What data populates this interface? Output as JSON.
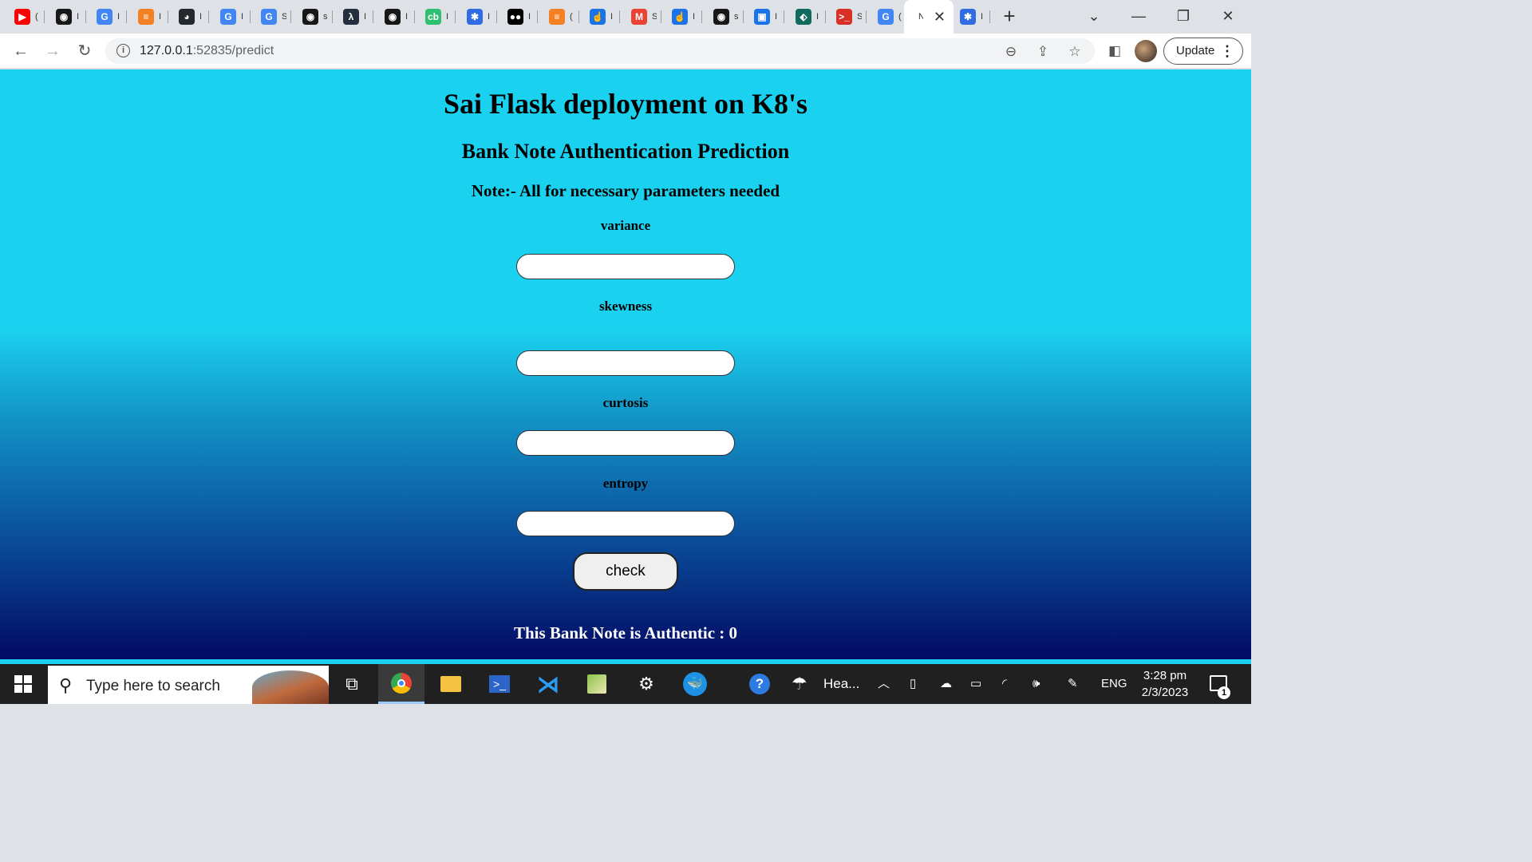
{
  "browser": {
    "tabs": [
      {
        "label": "(",
        "icon": "youtube-icon",
        "color": "#ff0000",
        "glyph": "▶"
      },
      {
        "label": "I",
        "icon": "github-icon",
        "color": "#181717",
        "glyph": "◉"
      },
      {
        "label": "I",
        "icon": "google-icon",
        "color": "#4285f4",
        "glyph": "G"
      },
      {
        "label": "I",
        "icon": "stackoverflow-icon",
        "color": "#f48024",
        "glyph": "≡"
      },
      {
        "label": "I",
        "icon": "octocat-icon",
        "color": "#24292e",
        "glyph": "◕"
      },
      {
        "label": "I",
        "icon": "google-icon",
        "color": "#4285f4",
        "glyph": "G"
      },
      {
        "label": "S",
        "icon": "google-icon",
        "color": "#4285f4",
        "glyph": "G"
      },
      {
        "label": "s",
        "icon": "github-icon",
        "color": "#181717",
        "glyph": "◉"
      },
      {
        "label": "I",
        "icon": "aws-lambda-icon",
        "color": "#232f3e",
        "glyph": "λ"
      },
      {
        "label": "I",
        "icon": "github-icon",
        "color": "#181717",
        "glyph": "◉"
      },
      {
        "label": "I",
        "icon": "cb-icon",
        "color": "#2fbf71",
        "glyph": "cb"
      },
      {
        "label": "I",
        "icon": "kubernetes-icon",
        "color": "#326ce5",
        "glyph": "✱"
      },
      {
        "label": "I",
        "icon": "medium-icon",
        "color": "#000000",
        "glyph": "●●"
      },
      {
        "label": "(",
        "icon": "stackoverflow-icon",
        "color": "#f48024",
        "glyph": "≡"
      },
      {
        "label": "I",
        "icon": "pointer-icon",
        "color": "#1a73e8",
        "glyph": "☝"
      },
      {
        "label": "S",
        "icon": "gmail-icon",
        "color": "#ea4335",
        "glyph": "M"
      },
      {
        "label": "I",
        "icon": "pointer-icon",
        "color": "#1a73e8",
        "glyph": "☝"
      },
      {
        "label": "s",
        "icon": "github-icon",
        "color": "#181717",
        "glyph": "◉"
      },
      {
        "label": "I",
        "icon": "screen-icon",
        "color": "#1a73e8",
        "glyph": "▣"
      },
      {
        "label": "I",
        "icon": "pin-icon",
        "color": "#0f6b5f",
        "glyph": "⬖"
      },
      {
        "label": "S",
        "icon": "terminal-icon",
        "color": "#d93025",
        "glyph": ">_"
      },
      {
        "label": "(",
        "icon": "google-icon",
        "color": "#4285f4",
        "glyph": "G"
      },
      {
        "label": "N",
        "icon": "blank-icon",
        "color": "#ffffff",
        "glyph": "",
        "active": true
      },
      {
        "label": "I",
        "icon": "kubernetes-icon",
        "color": "#326ce5",
        "glyph": "✱"
      }
    ],
    "url_host": "127.0.0.1",
    "url_path": ":52835/predict",
    "update_label": "Update"
  },
  "page": {
    "title": "Sai Flask deployment on K8's",
    "subtitle": "Bank Note Authentication Prediction",
    "note": "Note:- All for necessary parameters needed",
    "fields": [
      {
        "label": "variance",
        "value": ""
      },
      {
        "label": "skewness",
        "value": ""
      },
      {
        "label": "curtosis",
        "value": ""
      },
      {
        "label": "entropy",
        "value": ""
      }
    ],
    "button_label": "check",
    "result": "This Bank Note is Authentic : 0",
    "colors": {
      "background_top": "#1ad2ef",
      "background_bottom": "#020a63"
    }
  },
  "taskbar": {
    "search_placeholder": "Type here to search",
    "weather_label": "Hea...",
    "language": "ENG",
    "time": "3:28 pm",
    "date": "2/3/2023",
    "notification_count": "1"
  }
}
